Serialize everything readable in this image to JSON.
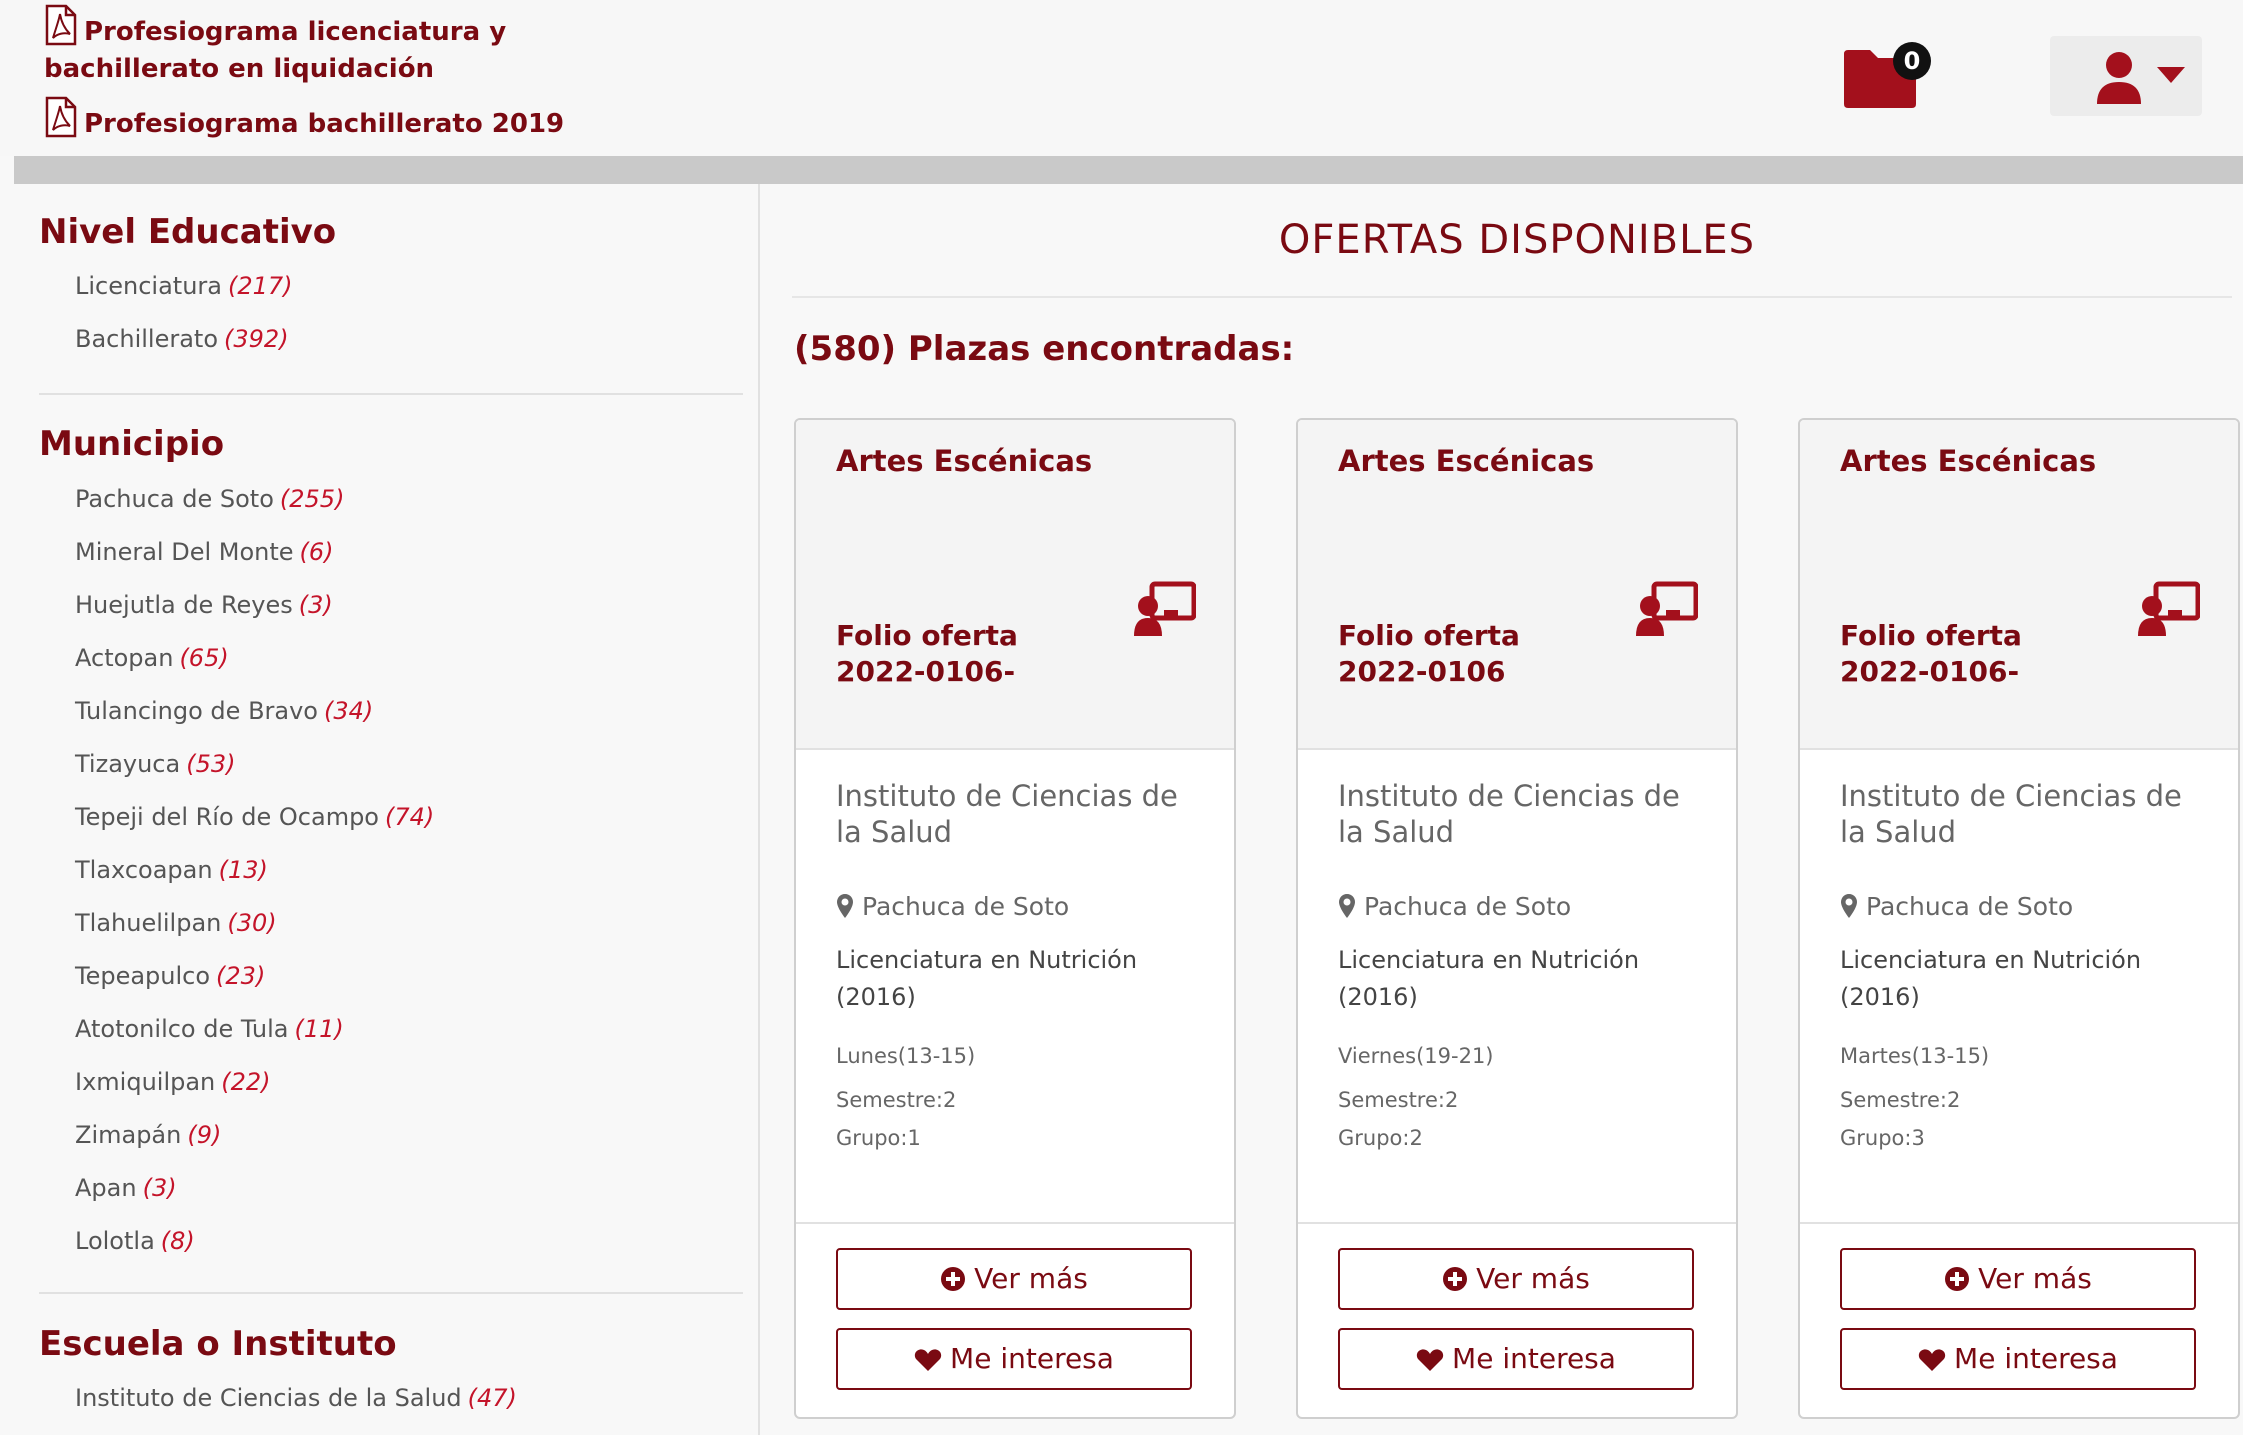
{
  "header": {
    "doc_links": [
      {
        "label": "Profesiograma licenciatura y bachillerato en liquidación"
      },
      {
        "label": "Profesiograma bachillerato 2019"
      }
    ],
    "folder_count": "0"
  },
  "sidebar": {
    "sections": [
      {
        "title": "Nivel Educativo",
        "items": [
          {
            "label": "Licenciatura",
            "count": "(217)"
          },
          {
            "label": "Bachillerato",
            "count": "(392)"
          }
        ]
      },
      {
        "title": "Municipio",
        "items": [
          {
            "label": "Pachuca de Soto",
            "count": "(255)"
          },
          {
            "label": "Mineral Del Monte",
            "count": "(6)"
          },
          {
            "label": "Huejutla de Reyes",
            "count": "(3)"
          },
          {
            "label": "Actopan",
            "count": "(65)"
          },
          {
            "label": "Tulancingo de Bravo",
            "count": "(34)"
          },
          {
            "label": "Tizayuca",
            "count": "(53)"
          },
          {
            "label": "Tepeji del Río de Ocampo",
            "count": "(74)"
          },
          {
            "label": "Tlaxcoapan",
            "count": "(13)"
          },
          {
            "label": "Tlahuelilpan",
            "count": "(30)"
          },
          {
            "label": "Tepeapulco",
            "count": "(23)"
          },
          {
            "label": "Atotonilco de Tula",
            "count": "(11)"
          },
          {
            "label": "Ixmiquilpan",
            "count": "(22)"
          },
          {
            "label": "Zimapán",
            "count": "(9)"
          },
          {
            "label": "Apan",
            "count": "(3)"
          },
          {
            "label": "Lolotla",
            "count": "(8)"
          }
        ]
      },
      {
        "title": "Escuela o Instituto",
        "items": [
          {
            "label": "Instituto de Ciencias de la Salud",
            "count": "(47)"
          }
        ]
      }
    ]
  },
  "main": {
    "title": "OFERTAS DISPONIBLES",
    "found": "(580) Plazas encontradas:",
    "cards": [
      {
        "title": "Artes Escénicas",
        "folio_label": "Folio oferta",
        "folio_value": "2022-0106-",
        "institute": "Instituto de Ciencias de la Salud",
        "location": "Pachuca de Soto",
        "program": "Licenciatura en Nutrición (2016)",
        "schedule": "Lunes(13-15)",
        "semester": "Semestre:2",
        "group": "Grupo:1",
        "more_label": "Ver más",
        "like_label": "Me interesa"
      },
      {
        "title": "Artes Escénicas",
        "folio_label": "Folio oferta",
        "folio_value": "2022-0106",
        "institute": "Instituto de Ciencias de la Salud",
        "location": "Pachuca de Soto",
        "program": "Licenciatura en Nutrición (2016)",
        "schedule": "Viernes(19-21)",
        "semester": "Semestre:2",
        "group": "Grupo:2",
        "more_label": "Ver más",
        "like_label": "Me interesa"
      },
      {
        "title": "Artes Escénicas",
        "folio_label": "Folio oferta",
        "folio_value": "2022-0106-",
        "institute": "Instituto de Ciencias de la Salud",
        "location": "Pachuca de Soto",
        "program": "Licenciatura en Nutrición (2016)",
        "schedule": "Martes(13-15)",
        "semester": "Semestre:2",
        "group": "Grupo:3",
        "more_label": "Ver más",
        "like_label": "Me interesa"
      }
    ]
  },
  "colors": {
    "brand": "#7a0a12",
    "count": "#c4142a"
  },
  "icons": [
    "pdf-icon",
    "folder-icon",
    "user-icon",
    "caret-down-icon",
    "teacher-icon",
    "map-pin-icon",
    "plus-circle-icon",
    "heart-icon"
  ]
}
